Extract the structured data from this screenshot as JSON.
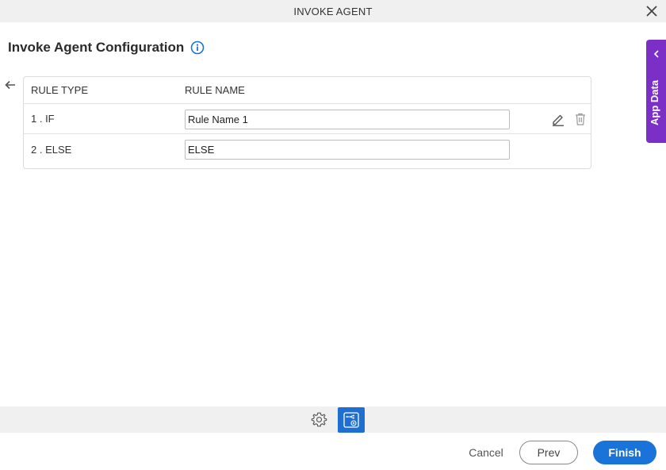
{
  "window": {
    "title": "INVOKE AGENT",
    "close_icon": "close-icon"
  },
  "header": {
    "page_title": "Invoke Agent Configuration",
    "info_icon": "info-icon"
  },
  "table": {
    "columns": [
      "RULE TYPE",
      "RULE NAME"
    ],
    "rows": [
      {
        "type": "1 . IF",
        "name": "Rule Name 1",
        "actions": [
          "edit-icon",
          "delete-icon"
        ]
      },
      {
        "type": "2 . ELSE",
        "name": "ELSE",
        "actions": []
      }
    ]
  },
  "side_panel": {
    "label": "App Data",
    "color": "#7b2fc7"
  },
  "toolbar": {
    "icons": [
      "gear-icon",
      "flow-icon"
    ],
    "active_color": "#1f6fd1"
  },
  "footer": {
    "cancel_label": "Cancel",
    "prev_label": "Prev",
    "finish_label": "Finish",
    "finish_color": "#1a73d9"
  }
}
